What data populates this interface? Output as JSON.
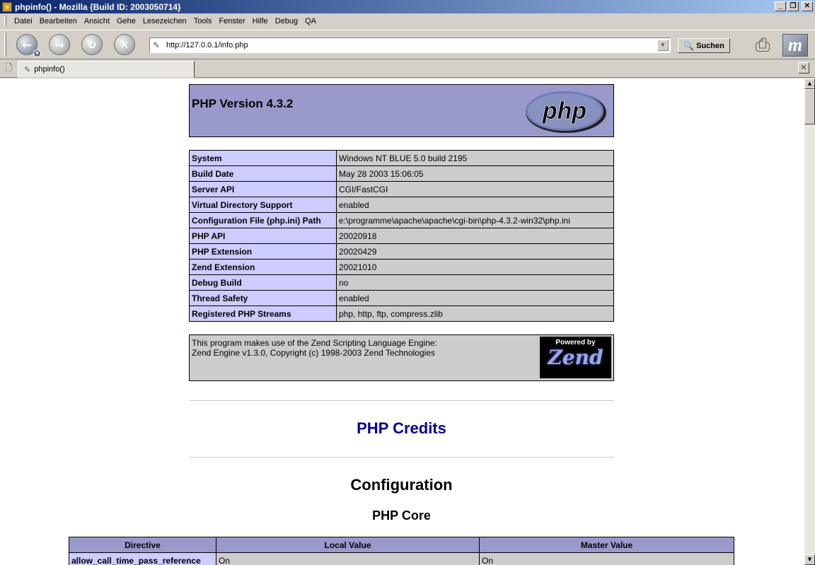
{
  "window": {
    "title": "phpinfo() - Mozilla {Build ID: 2003050714}",
    "btn_minimize": "_",
    "btn_maximize": "❐",
    "btn_close": "✕"
  },
  "menu": [
    "Datei",
    "Bearbeiten",
    "Ansicht",
    "Gehe",
    "Lesezeichen",
    "Tools",
    "Fenster",
    "Hilfe",
    "Debug",
    "QA"
  ],
  "navigation": {
    "back": "←",
    "forward": "→",
    "reload": "↻",
    "stop": "✕",
    "url": "http://127.0.0.1/info.php",
    "search_label": "Suchen"
  },
  "tab": {
    "label": "phpinfo()",
    "close": "✕"
  },
  "php": {
    "version": "PHP Version 4.3.2",
    "logo_text": "php",
    "system_rows": [
      {
        "key": "System",
        "value": "Windows NT BLUE 5.0 build 2195"
      },
      {
        "key": "Build Date",
        "value": "May 28 2003 15:06:05"
      },
      {
        "key": "Server API",
        "value": "CGI/FastCGI"
      },
      {
        "key": "Virtual Directory Support",
        "value": "enabled"
      },
      {
        "key": "Configuration File (php.ini) Path",
        "value": "e:\\programme\\apache\\apache\\cgi-bin\\php-4.3.2-win32\\php.ini"
      },
      {
        "key": "PHP API",
        "value": "20020918"
      },
      {
        "key": "PHP Extension",
        "value": "20020429"
      },
      {
        "key": "Zend Extension",
        "value": "20021010"
      },
      {
        "key": "Debug Build",
        "value": "no"
      },
      {
        "key": "Thread Safety",
        "value": "enabled"
      },
      {
        "key": "Registered PHP Streams",
        "value": "php, http, ftp, compress.zlib"
      }
    ],
    "zend_line1": "This program makes use of the Zend Scripting Language Engine:",
    "zend_line2": "Zend Engine v1.3.0, Copyright (c) 1998-2003 Zend Technologies",
    "zend_logo_top": "Powered by",
    "zend_logo_name": "Zend",
    "credits": "PHP Credits",
    "configuration": "Configuration",
    "core": "PHP Core",
    "directive_headers": [
      "Directive",
      "Local Value",
      "Master Value"
    ],
    "directive_rows": [
      {
        "directive": "allow_call_time_pass_reference",
        "local": "On",
        "master": "On"
      }
    ]
  }
}
